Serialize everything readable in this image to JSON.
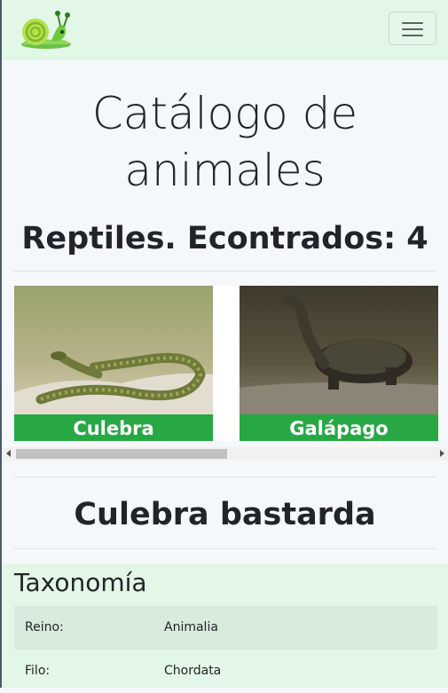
{
  "navbar": {
    "logo_icon": "snail-icon",
    "menu_icon": "hamburger-menu-icon"
  },
  "page": {
    "title": "Catálogo de animales"
  },
  "catalog": {
    "heading": "Reptiles. Econtrados: 4",
    "items": [
      {
        "label": "Culebra",
        "image_icon": "snake-photo"
      },
      {
        "label": "Galápago",
        "image_icon": "turtle-photo"
      }
    ]
  },
  "detail": {
    "name": "Culebra bastarda",
    "taxonomy_title": "Taxonomía",
    "taxonomy": [
      {
        "key": "Reino:",
        "value": "Animalia"
      },
      {
        "key": "Filo:",
        "value": "Chordata"
      }
    ]
  },
  "colors": {
    "navbar": "#e3f7e6",
    "label_green": "#28a745",
    "page_bg": "#f5f8fb"
  }
}
